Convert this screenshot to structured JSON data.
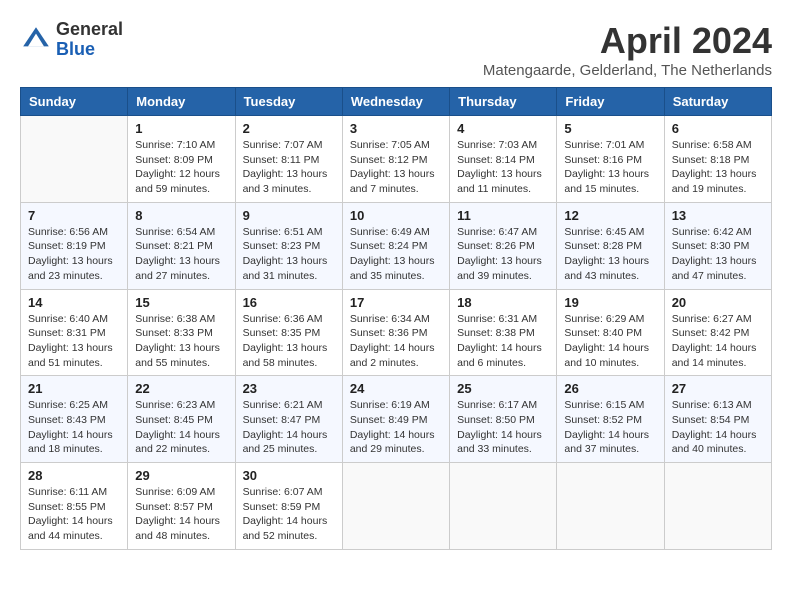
{
  "logo": {
    "general": "General",
    "blue": "Blue"
  },
  "title": "April 2024",
  "subtitle": "Matengaarde, Gelderland, The Netherlands",
  "days_of_week": [
    "Sunday",
    "Monday",
    "Tuesday",
    "Wednesday",
    "Thursday",
    "Friday",
    "Saturday"
  ],
  "weeks": [
    [
      {
        "day": "",
        "info": ""
      },
      {
        "day": "1",
        "info": "Sunrise: 7:10 AM\nSunset: 8:09 PM\nDaylight: 12 hours\nand 59 minutes."
      },
      {
        "day": "2",
        "info": "Sunrise: 7:07 AM\nSunset: 8:11 PM\nDaylight: 13 hours\nand 3 minutes."
      },
      {
        "day": "3",
        "info": "Sunrise: 7:05 AM\nSunset: 8:12 PM\nDaylight: 13 hours\nand 7 minutes."
      },
      {
        "day": "4",
        "info": "Sunrise: 7:03 AM\nSunset: 8:14 PM\nDaylight: 13 hours\nand 11 minutes."
      },
      {
        "day": "5",
        "info": "Sunrise: 7:01 AM\nSunset: 8:16 PM\nDaylight: 13 hours\nand 15 minutes."
      },
      {
        "day": "6",
        "info": "Sunrise: 6:58 AM\nSunset: 8:18 PM\nDaylight: 13 hours\nand 19 minutes."
      }
    ],
    [
      {
        "day": "7",
        "info": "Sunrise: 6:56 AM\nSunset: 8:19 PM\nDaylight: 13 hours\nand 23 minutes."
      },
      {
        "day": "8",
        "info": "Sunrise: 6:54 AM\nSunset: 8:21 PM\nDaylight: 13 hours\nand 27 minutes."
      },
      {
        "day": "9",
        "info": "Sunrise: 6:51 AM\nSunset: 8:23 PM\nDaylight: 13 hours\nand 31 minutes."
      },
      {
        "day": "10",
        "info": "Sunrise: 6:49 AM\nSunset: 8:24 PM\nDaylight: 13 hours\nand 35 minutes."
      },
      {
        "day": "11",
        "info": "Sunrise: 6:47 AM\nSunset: 8:26 PM\nDaylight: 13 hours\nand 39 minutes."
      },
      {
        "day": "12",
        "info": "Sunrise: 6:45 AM\nSunset: 8:28 PM\nDaylight: 13 hours\nand 43 minutes."
      },
      {
        "day": "13",
        "info": "Sunrise: 6:42 AM\nSunset: 8:30 PM\nDaylight: 13 hours\nand 47 minutes."
      }
    ],
    [
      {
        "day": "14",
        "info": "Sunrise: 6:40 AM\nSunset: 8:31 PM\nDaylight: 13 hours\nand 51 minutes."
      },
      {
        "day": "15",
        "info": "Sunrise: 6:38 AM\nSunset: 8:33 PM\nDaylight: 13 hours\nand 55 minutes."
      },
      {
        "day": "16",
        "info": "Sunrise: 6:36 AM\nSunset: 8:35 PM\nDaylight: 13 hours\nand 58 minutes."
      },
      {
        "day": "17",
        "info": "Sunrise: 6:34 AM\nSunset: 8:36 PM\nDaylight: 14 hours\nand 2 minutes."
      },
      {
        "day": "18",
        "info": "Sunrise: 6:31 AM\nSunset: 8:38 PM\nDaylight: 14 hours\nand 6 minutes."
      },
      {
        "day": "19",
        "info": "Sunrise: 6:29 AM\nSunset: 8:40 PM\nDaylight: 14 hours\nand 10 minutes."
      },
      {
        "day": "20",
        "info": "Sunrise: 6:27 AM\nSunset: 8:42 PM\nDaylight: 14 hours\nand 14 minutes."
      }
    ],
    [
      {
        "day": "21",
        "info": "Sunrise: 6:25 AM\nSunset: 8:43 PM\nDaylight: 14 hours\nand 18 minutes."
      },
      {
        "day": "22",
        "info": "Sunrise: 6:23 AM\nSunset: 8:45 PM\nDaylight: 14 hours\nand 22 minutes."
      },
      {
        "day": "23",
        "info": "Sunrise: 6:21 AM\nSunset: 8:47 PM\nDaylight: 14 hours\nand 25 minutes."
      },
      {
        "day": "24",
        "info": "Sunrise: 6:19 AM\nSunset: 8:49 PM\nDaylight: 14 hours\nand 29 minutes."
      },
      {
        "day": "25",
        "info": "Sunrise: 6:17 AM\nSunset: 8:50 PM\nDaylight: 14 hours\nand 33 minutes."
      },
      {
        "day": "26",
        "info": "Sunrise: 6:15 AM\nSunset: 8:52 PM\nDaylight: 14 hours\nand 37 minutes."
      },
      {
        "day": "27",
        "info": "Sunrise: 6:13 AM\nSunset: 8:54 PM\nDaylight: 14 hours\nand 40 minutes."
      }
    ],
    [
      {
        "day": "28",
        "info": "Sunrise: 6:11 AM\nSunset: 8:55 PM\nDaylight: 14 hours\nand 44 minutes."
      },
      {
        "day": "29",
        "info": "Sunrise: 6:09 AM\nSunset: 8:57 PM\nDaylight: 14 hours\nand 48 minutes."
      },
      {
        "day": "30",
        "info": "Sunrise: 6:07 AM\nSunset: 8:59 PM\nDaylight: 14 hours\nand 52 minutes."
      },
      {
        "day": "",
        "info": ""
      },
      {
        "day": "",
        "info": ""
      },
      {
        "day": "",
        "info": ""
      },
      {
        "day": "",
        "info": ""
      }
    ]
  ]
}
